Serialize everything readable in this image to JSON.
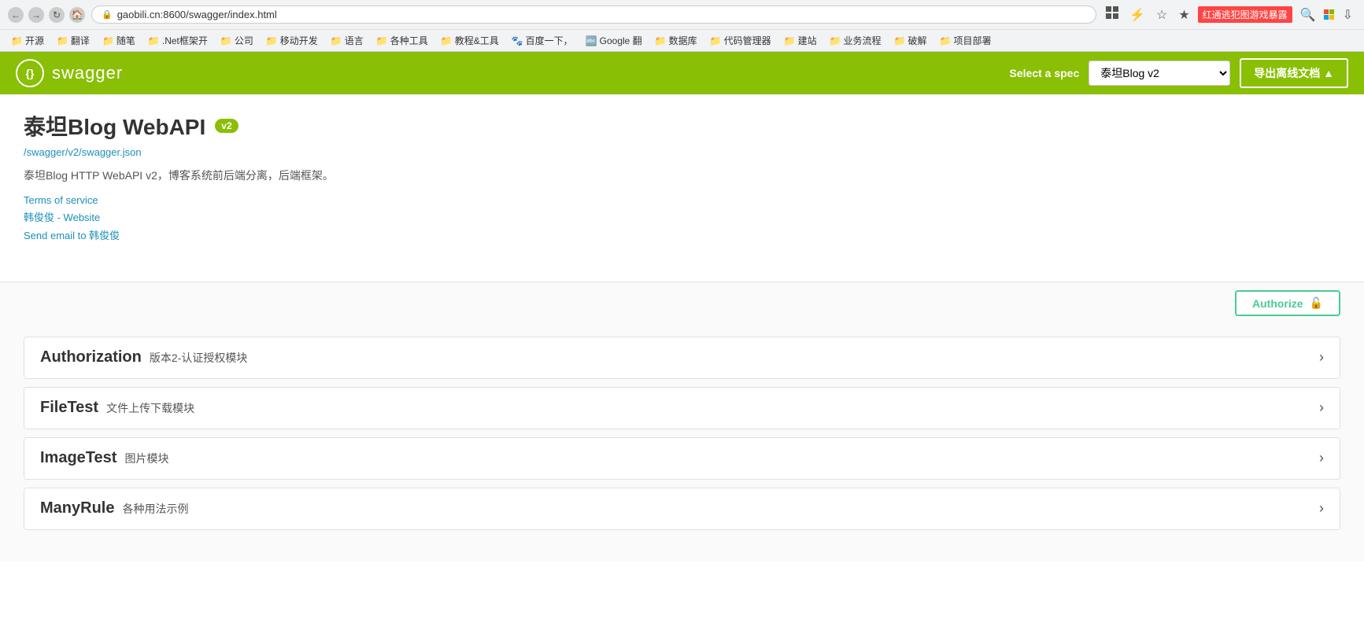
{
  "browser": {
    "address": "gaobili.cn:8600/swagger/index.html",
    "bookmarks": [
      {
        "label": "开源",
        "icon": "📁"
      },
      {
        "label": "翻译",
        "icon": "📁"
      },
      {
        "label": "随笔",
        "icon": "📁"
      },
      {
        "label": ".Net框架开",
        "icon": "📁"
      },
      {
        "label": "公司",
        "icon": "📁"
      },
      {
        "label": "移动开发",
        "icon": "📁"
      },
      {
        "label": "语言",
        "icon": "📁"
      },
      {
        "label": "各种工具",
        "icon": "📁"
      },
      {
        "label": "教程&工具",
        "icon": "📁"
      },
      {
        "label": "百度一下，",
        "icon": "🐾"
      },
      {
        "label": "Google 翻",
        "icon": "🔤"
      },
      {
        "label": "数据库",
        "icon": "📁"
      },
      {
        "label": "代码管理器",
        "icon": "📁"
      },
      {
        "label": "建站",
        "icon": "📁"
      },
      {
        "label": "业务流程",
        "icon": "📁"
      },
      {
        "label": "破解",
        "icon": "📁"
      },
      {
        "label": "项目部署",
        "icon": "📁"
      }
    ],
    "rightSideText": "红通逃犯图游戏暴露"
  },
  "swagger": {
    "logo_text": "swagger",
    "logo_symbol": "{}",
    "header": {
      "select_spec_label": "Select a spec",
      "spec_options": [
        "泰坦Blog v2"
      ],
      "spec_selected": "泰坦Blog v2",
      "export_btn_label": "导出离线文档 ▲"
    },
    "info": {
      "title": "泰坦Blog WebAPI",
      "version_badge": "v2",
      "spec_url": "/swagger/v2/swagger.json",
      "description": "泰坦Blog HTTP WebAPI v2，博客系统前后端分离，后端框架。",
      "terms_of_service": "Terms of service",
      "website_link": "韩俊俊 - Website",
      "email_link": "Send email to 韩俊俊"
    },
    "authorize_btn_label": "Authorize",
    "api_groups": [
      {
        "name": "Authorization",
        "desc": "版本2-认证授权模块"
      },
      {
        "name": "FileTest",
        "desc": "文件上传下载模块"
      },
      {
        "name": "ImageTest",
        "desc": "图片模块"
      },
      {
        "name": "ManyRule",
        "desc": "各种用法示例"
      }
    ]
  }
}
